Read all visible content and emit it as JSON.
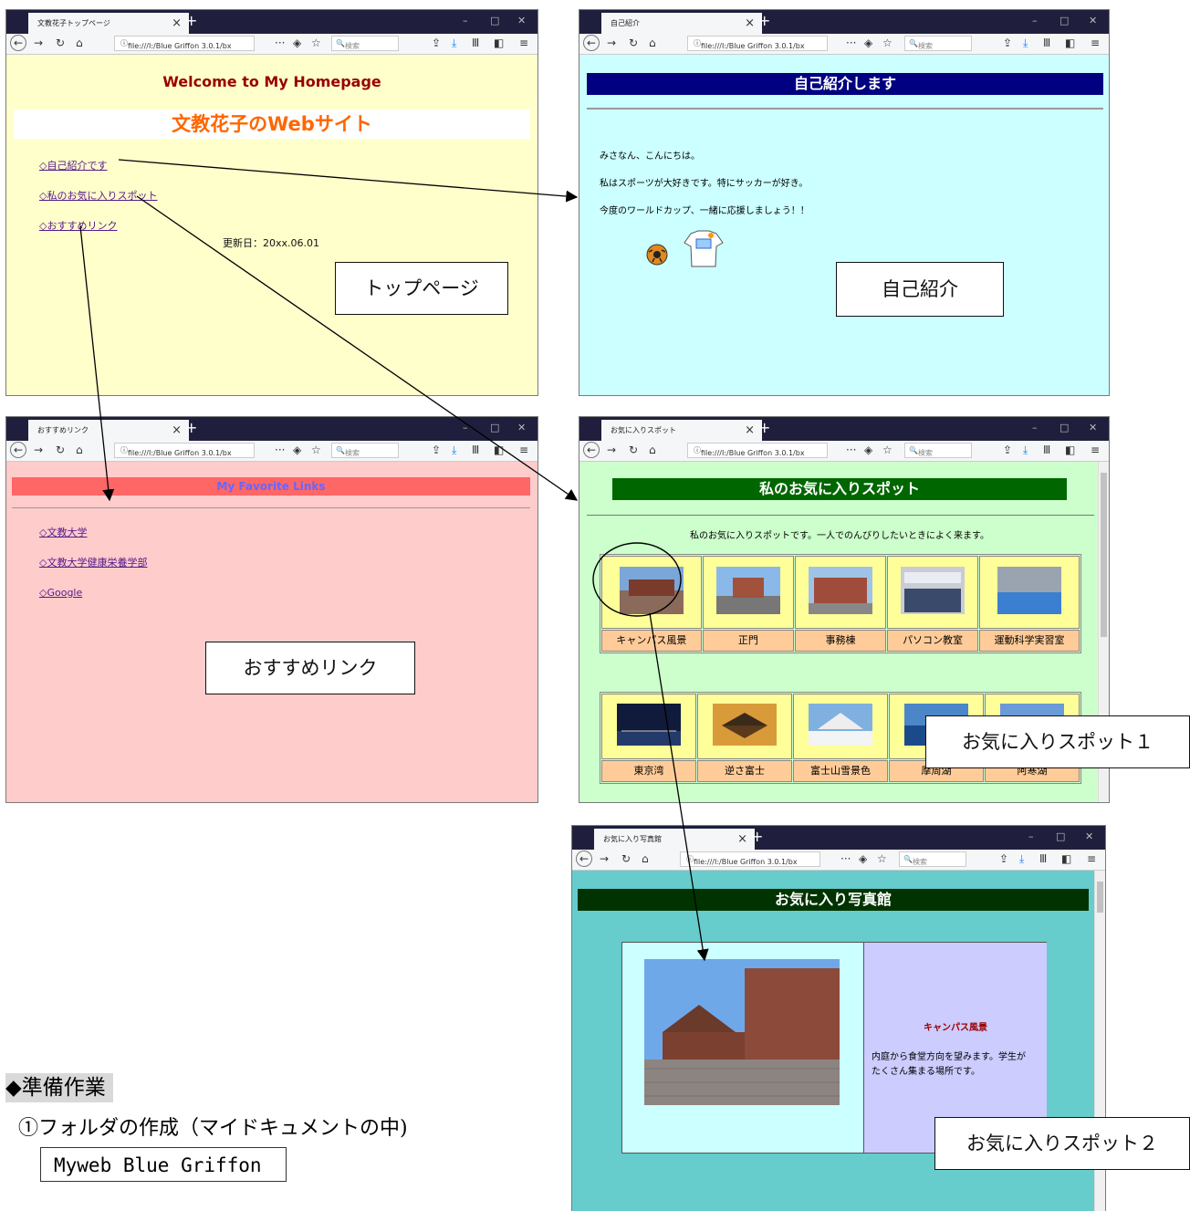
{
  "top": {
    "tab_title": "文教花子トップページ",
    "url": "file:///I:/Blue Griffon 3.0.1/bx",
    "search_placeholder": "検索",
    "welcome": "Welcome to My Homepage",
    "site_title": "文教花子のWebサイト",
    "links": [
      "◇自己紹介です",
      "◇私のお気に入りスポット",
      "◇おすすめリンク"
    ],
    "updated": "更新日：20xx.06.01",
    "label": "トップページ"
  },
  "intro": {
    "tab_title": "自己紹介",
    "url": "file:///I:/Blue Griffon 3.0.1/bx",
    "search_placeholder": "検索",
    "heading": "自己紹介します",
    "lines": [
      "みさなん、こんにちは。",
      "私はスポーツが大好きです。特にサッカーが好き。",
      "今度のワールドカップ、一緒に応援しましょう！！"
    ],
    "label": "自己紹介"
  },
  "recommend": {
    "tab_title": "おすすめリンク",
    "url": "file:///I:/Blue Griffon 3.0.1/bx",
    "search_placeholder": "検索",
    "heading": "My Favorite Links",
    "links": [
      "◇文教大学",
      "◇文教大学健康栄養学部",
      "◇Google"
    ],
    "label": "おすすめリンク"
  },
  "spots": {
    "tab_title": "お気に入りスポット",
    "url": "file:///I:/Blue Griffon 3.0.1/bx",
    "search_placeholder": "検索",
    "heading": "私のお気に入りスポット",
    "intro": "私のお気に入りスポットです。一人でのんびりしたいときによく来ます。",
    "row1": [
      "キャンパス風景",
      "正門",
      "事務棟",
      "パソコン教室",
      "運動科学実習室"
    ],
    "row2": [
      "東京湾",
      "逆さ富士",
      "富士山雪景色",
      "摩周湖",
      "阿寒湖"
    ],
    "label": "お気に入りスポット１"
  },
  "gallery": {
    "tab_title": "お気に入り写真館",
    "url": "file:///I:/Blue Griffon 3.0.1/bx",
    "search_placeholder": "検索",
    "heading": "お気に入り写真館",
    "photo_title": "キャンパス風景",
    "photo_desc": "内庭から食堂方向を望みます。学生がたくさん集まる場所です。",
    "label": "お気に入りスポット２"
  },
  "prep": {
    "heading": "◆準備作業",
    "step1": "①フォルダの作成（マイドキュメントの中)",
    "folder": "Myweb Blue Griffon"
  },
  "colors": {
    "top_bg": "#ffffcc",
    "intro_bg": "#ccffff",
    "recommend_bg": "#ffcccc",
    "spots_bg": "#ccffcc",
    "gallery_bg": "#66cccc",
    "heading_navy": "#000080",
    "heading_green": "#006600",
    "heading_dark_green": "#003300",
    "orange": "#ff6600",
    "maroon": "#990000"
  }
}
